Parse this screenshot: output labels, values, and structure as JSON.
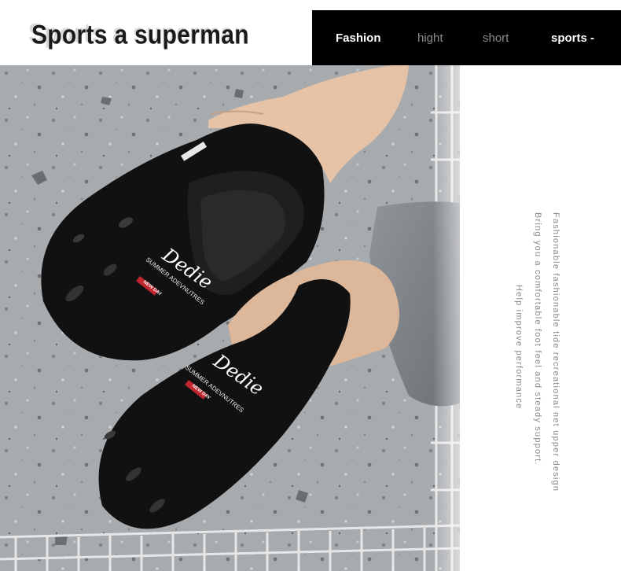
{
  "header": {
    "title": "Sports a superman",
    "title_shadow": "Sports a superman"
  },
  "nav": {
    "items": [
      {
        "label": "Fashion",
        "color": "#ffffff"
      },
      {
        "label": "hight",
        "color": "#8c8c8c"
      },
      {
        "label": "short",
        "color": "#8c8c8c"
      },
      {
        "label": "sports -",
        "color": "#ffffff"
      }
    ]
  },
  "photo": {
    "logo_script": "Dedie",
    "logo_line": "SUMMER ADEVNUTRES",
    "logo_badge": "NEW DAY",
    "colors": {
      "shoe": "#111111",
      "floor": "#a9adb0",
      "grid": "#ffffff",
      "accent": "#c0262d"
    }
  },
  "description": {
    "line1": "Fashionable fashionable tide recreational net upper design",
    "line2": "Bring you a comfortable foot feel and steady support.",
    "line3": "Help improve performance"
  }
}
